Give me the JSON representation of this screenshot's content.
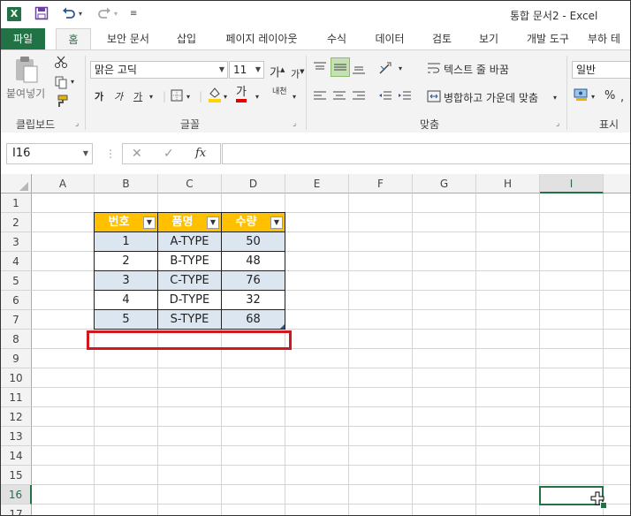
{
  "window": {
    "title": "통합 문서2 - Excel",
    "logo_letter": "X"
  },
  "quick_access": {
    "save_icon": "save-icon",
    "undo_icon": "undo-icon",
    "redo_icon": "redo-icon"
  },
  "tabs": [
    {
      "label": "파일"
    },
    {
      "label": "홈"
    },
    {
      "label": "보안 문서"
    },
    {
      "label": "삽입"
    },
    {
      "label": "페이지 레이아웃"
    },
    {
      "label": "수식"
    },
    {
      "label": "데이터"
    },
    {
      "label": "검토"
    },
    {
      "label": "보기"
    },
    {
      "label": "개발 도구"
    },
    {
      "label": "부하 테"
    }
  ],
  "ribbon": {
    "clipboard": {
      "paste_label": "붙여넣기",
      "group_label": "클립보드"
    },
    "font": {
      "font_name": "맑은 고딕",
      "font_size": "11",
      "bold": "가",
      "italic": "가",
      "underline": "가",
      "grow": "가",
      "shrink": "가",
      "font_color_glyph": "가",
      "phonetic": "내천",
      "group_label": "글꼴"
    },
    "alignment": {
      "wrap_text": "텍스트 줄 바꿈",
      "merge_center": "병합하고 가운데 맞춤",
      "group_label": "맞춤"
    },
    "number": {
      "format": "일반",
      "percent": "%",
      "group_label": "표시 형"
    }
  },
  "formula_bar": {
    "name_box": "I16",
    "fx_label": "fx",
    "formula": ""
  },
  "sheet": {
    "columns": [
      "A",
      "B",
      "C",
      "D",
      "E",
      "F",
      "G",
      "H",
      "I"
    ],
    "rows": [
      "1",
      "2",
      "3",
      "4",
      "5",
      "6",
      "7",
      "8",
      "9",
      "10",
      "11",
      "12",
      "13",
      "14",
      "15",
      "16",
      "17"
    ],
    "selected_column": "I",
    "selected_row": "16",
    "table": {
      "headers": [
        "번호",
        "품명",
        "수량"
      ],
      "rows": [
        [
          "1",
          "A-TYPE",
          "50"
        ],
        [
          "2",
          "B-TYPE",
          "48"
        ],
        [
          "3",
          "C-TYPE",
          "76"
        ],
        [
          "4",
          "D-TYPE",
          "32"
        ],
        [
          "5",
          "S-TYPE",
          "68"
        ]
      ]
    }
  },
  "colors": {
    "excel_green": "#217346",
    "table_header": "#ffc000",
    "table_band": "#dce6f1",
    "highlight_red": "#d0191f"
  }
}
